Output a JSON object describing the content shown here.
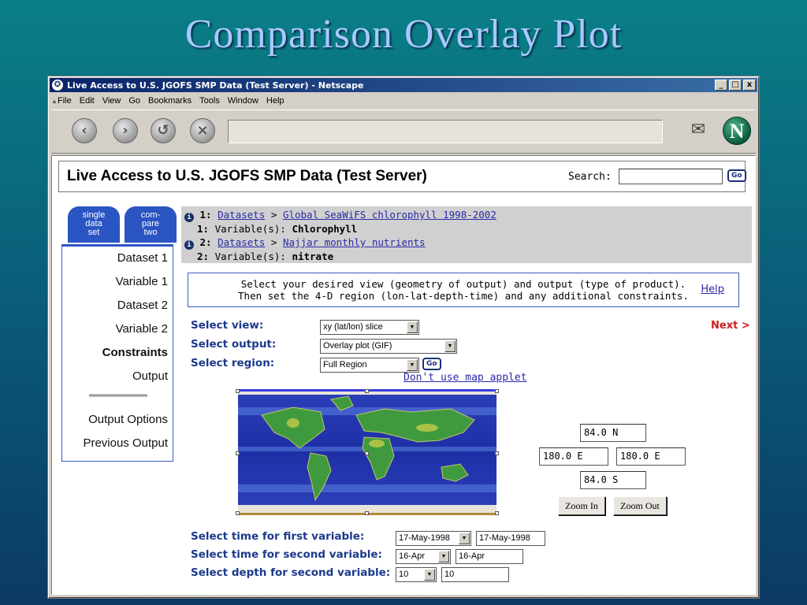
{
  "slide": {
    "title": "Comparison  Overlay  Plot"
  },
  "window": {
    "title": "Live Access to U.S. JGOFS SMP Data (Test Server) - Netscape",
    "buttons": [
      "_",
      "□",
      "x"
    ],
    "menu": [
      "File",
      "Edit",
      "View",
      "Go",
      "Bookmarks",
      "Tools",
      "Window",
      "Help"
    ]
  },
  "nav": {
    "icons": [
      "back-icon",
      "forward-icon",
      "reload-icon",
      "stop-icon",
      "mail-icon",
      "netscape-logo-icon"
    ],
    "logo_letter": "N"
  },
  "header": {
    "title": "Live Access to U.S. JGOFS SMP Data (Test Server)",
    "search_label": "Search:",
    "search_value": "",
    "go_label": "Go"
  },
  "tabs": {
    "single": "single\ndata\nset",
    "compare": "com-\npare\ntwo"
  },
  "sidebar": {
    "items": [
      "Dataset 1",
      "Variable 1",
      "Dataset 2",
      "Variable 2",
      "Constraints",
      "Output"
    ],
    "items2": [
      "Output Options",
      "Previous Output"
    ],
    "active": "Constraints"
  },
  "crumbs": {
    "line1_prefix": "1:",
    "line1_link1": "Datasets",
    "line1_sep": ">",
    "line1_link2": "Global SeaWiFS chlorophyll 1998-2002",
    "line2_prefix": "1:",
    "line2_label": "Variable(s):",
    "line2_value": "Chlorophyll",
    "line3_prefix": "2:",
    "line3_link1": "Datasets",
    "line3_sep": ">",
    "line3_link2": "Najjar monthly nutrients",
    "line4_prefix": "2:",
    "line4_label": "Variable(s):",
    "line4_value": "nitrate"
  },
  "instructions": {
    "line1": "Select your desired view (geometry of output) and output (type of product).",
    "line2": "Then set the 4-D region (lon-lat-depth-time) and any additional constraints.",
    "help": "Help"
  },
  "form": {
    "view_label": "Select view:",
    "view_value": "xy (lat/lon) slice",
    "output_label": "Select output:",
    "output_value": "Overlay plot (GIF)",
    "region_label": "Select region:",
    "region_value": "Full Region",
    "go_label": "Go",
    "next": "Next >",
    "map_link": "Don't use map applet",
    "lat_north": "84.0 N",
    "lon_west": "180.0 E",
    "lon_east": "180.0 E",
    "lat_south": "84.0 S",
    "zoom_in": "Zoom In",
    "zoom_out": "Zoom Out",
    "time1_label": "Select time for first variable:",
    "time1_select": "17-May-1998",
    "time1_text": "17-May-1998",
    "time2_label": "Select time for second variable:",
    "time2_select": "16-Apr",
    "time2_text": "16-Apr",
    "depth2_label": "Select depth for second variable:",
    "depth2_select": "10",
    "depth2_text": "10"
  },
  "colors": {
    "accent": "#2a55c2",
    "label": "#1c3a8c",
    "next": "#cc1f1f",
    "link": "#2a2aa8"
  }
}
